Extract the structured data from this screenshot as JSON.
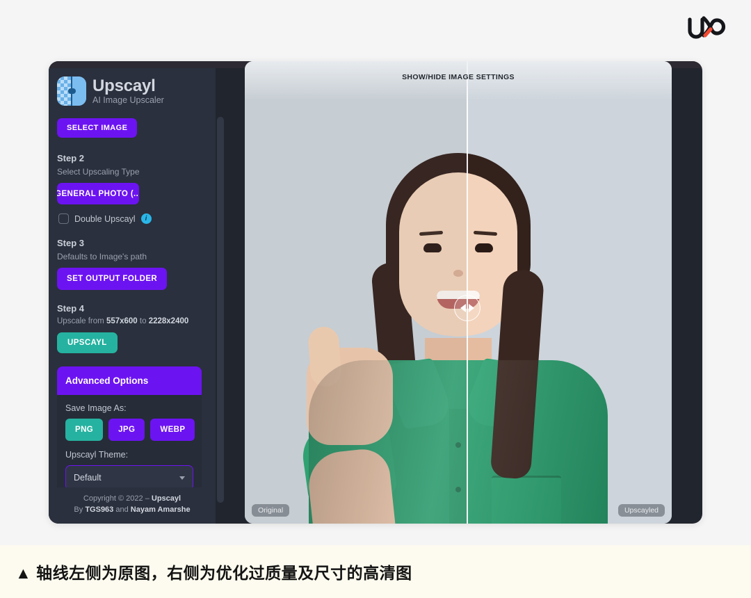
{
  "page": {
    "background_top": "#f5f5f6",
    "background_caption": "#fdfbef",
    "caption": "▲ 轴线左侧为原图，右侧为优化过质量及尺寸的高清图"
  },
  "brand_logo": {
    "icon": "uxo-infinity-logo",
    "accent": "#f04a32"
  },
  "app": {
    "name": "Upscayl",
    "tagline": "AI Image Upscaler",
    "icon": "upscayl-app-icon",
    "colors": {
      "purple": "#6c13f2",
      "teal": "#26b2a0",
      "sidebar": "#2a303d",
      "frame": "#21252e"
    }
  },
  "sidebar": {
    "select_image_label": "SELECT IMAGE",
    "steps": [
      {
        "title": "Step 2",
        "subtitle": "Select Upscaling Type",
        "button": "GENERAL PHOTO (..."
      },
      {
        "title": "Step 3",
        "subtitle": "Defaults to Image's path",
        "button": "SET OUTPUT FOLDER"
      },
      {
        "title": "Step 4",
        "button": "UPSCAYL"
      }
    ],
    "double_upscayl": {
      "label": "Double Upscayl",
      "checked": false,
      "info_icon": "info-icon"
    },
    "upscale_info": {
      "prefix": "Upscale from ",
      "from": "557x600",
      "middle": " to ",
      "to": "2228x2400"
    },
    "advanced": {
      "header": "Advanced Options",
      "save_image_as_label": "Save Image As:",
      "formats": [
        {
          "label": "PNG",
          "selected": true
        },
        {
          "label": "JPG",
          "selected": false
        },
        {
          "label": "WEBP",
          "selected": false
        }
      ],
      "theme_label": "Upscayl Theme:",
      "theme_value": "Default"
    },
    "footer": {
      "line1_prefix": "Copyright © 2022 – ",
      "line1_bold": "Upscayl",
      "line2_prefix": "By ",
      "line2_bold1": "TGS963",
      "line2_middle": " and ",
      "line2_bold2": "Nayam Amarshe"
    }
  },
  "viewer": {
    "settings_toggle": "SHOW/HIDE IMAGE SETTINGS",
    "tag_left": "Original",
    "tag_right": "Upscayled",
    "slider_handle": "compare-slider-handle",
    "split_percent": 52
  }
}
